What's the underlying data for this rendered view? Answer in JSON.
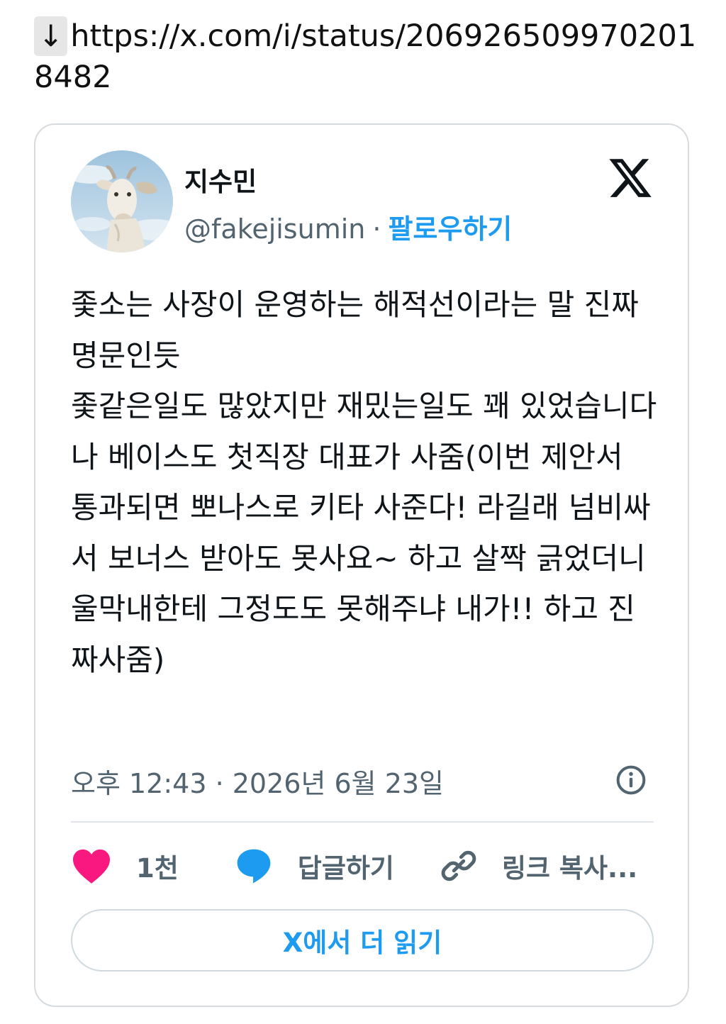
{
  "header": {
    "arrow": "↓",
    "url": "https://x.com/i/status/2069265099702018482"
  },
  "tweet": {
    "avatar_icon": "goat-avatar",
    "display_name": "지수민",
    "handle": "@fakejisumin",
    "separator": "·",
    "follow_label": "팔로우하기",
    "logo_icon": "x-logo-icon",
    "text": "좇소는 사장이 운영하는 해적선이라는 말 진짜 명문인듯\n좇같은일도 많았지만 재밌는일도 꽤 있었습니다\n나 베이스도 첫직장 대표가 사줌(이번 제안서 통과되면 뽀나스로 키타 사준다! 라길래 넘비싸서 보너스 받아도 못사요~ 하고 살짝 긁었더니 울막내한테 그정도도 못해주냐 내가!! 하고 진짜사줌)",
    "timestamp": "오후 12:43 · 2026년 6월 23일",
    "info_icon": "info-icon",
    "actions": {
      "like_count": "1천",
      "reply_label": "답글하기",
      "copy_link_label": "링크 복사..."
    },
    "read_more_label": "X에서 더 읽기"
  },
  "colors": {
    "accent": "#1d9bf0",
    "like": "#f91880",
    "secondary_text": "#536471",
    "border": "#d6dbdf"
  }
}
